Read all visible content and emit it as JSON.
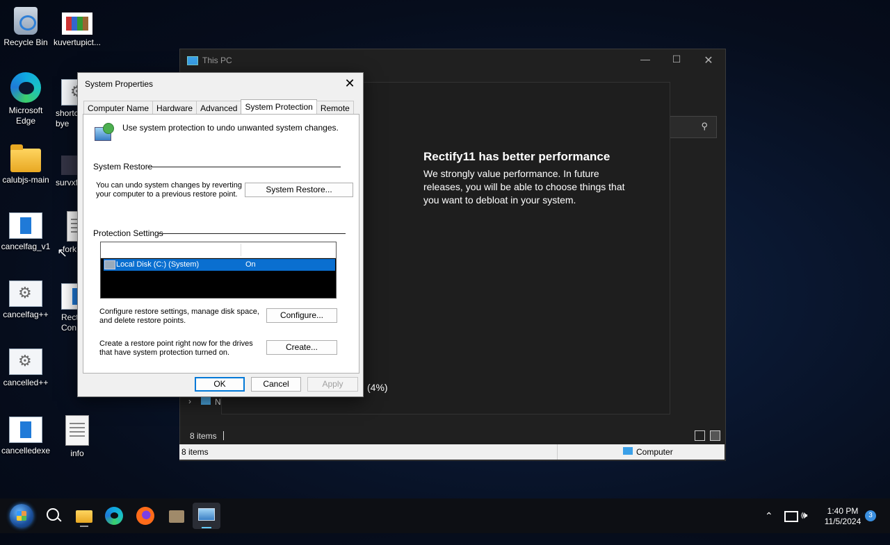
{
  "desktop": {
    "icons": [
      {
        "label": "Recycle Bin"
      },
      {
        "label": "kuvertupict..."
      },
      {
        "label": "Microsoft Edge"
      },
      {
        "label": "shortc bye"
      },
      {
        "label": "calubjs-main"
      },
      {
        "label": "survxf"
      },
      {
        "label": "cancelfag_v1"
      },
      {
        "label": "fork"
      },
      {
        "label": "cancelfag++"
      },
      {
        "label": "Rect Con"
      },
      {
        "label": "cancelled++"
      },
      {
        "label": "cancelledexe"
      },
      {
        "label": "info"
      }
    ]
  },
  "explorer": {
    "title": "This PC",
    "items_count": "8 items",
    "status_left": "8 items",
    "status_right": "Computer",
    "nav_partial": "N"
  },
  "overlay": {
    "heading": "Rectify11 has better performance",
    "body": "We strongly value performance. In future releases, you will be able to choose things that you want to debloat in your system.",
    "progress_text": "(4%)"
  },
  "dialog": {
    "title": "System Properties",
    "tabs": [
      "Computer Name",
      "Hardware",
      "Advanced",
      "System Protection",
      "Remote"
    ],
    "active_tab": "System Protection",
    "intro": "Use system protection to undo unwanted system changes.",
    "system_restore": {
      "heading": "System Restore",
      "description": "You can undo system changes by reverting your computer to a previous restore point.",
      "button": "System Restore..."
    },
    "protection_settings": {
      "heading": "Protection Settings",
      "drives": [
        {
          "name": "Local Disk (C:) (System)",
          "protection": "On"
        }
      ],
      "configure_text": "Configure restore settings, manage disk space, and delete restore points.",
      "configure_button": "Configure...",
      "create_text": "Create a restore point right now for the drives that have system protection turned on.",
      "create_button": "Create..."
    },
    "ok": "OK",
    "cancel": "Cancel",
    "apply": "Apply"
  },
  "taskbar": {
    "time": "1:40 PM",
    "date": "11/5/2024",
    "notification_count": "3"
  }
}
